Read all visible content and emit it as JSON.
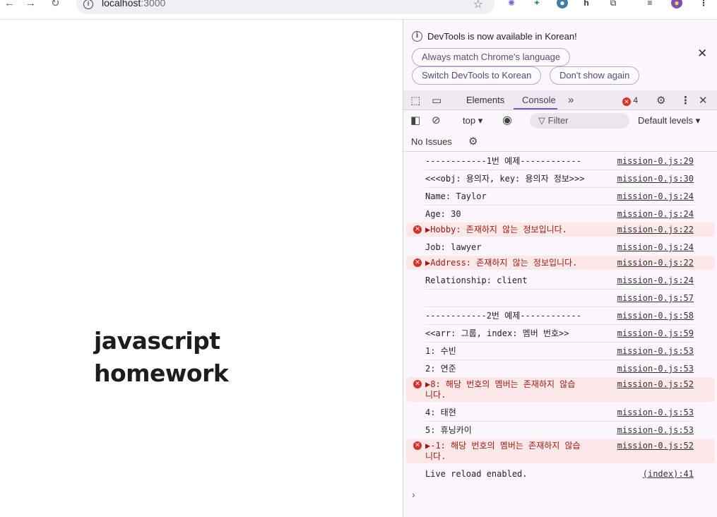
{
  "browser": {
    "url_host": "localhost",
    "url_port": ":3000"
  },
  "page": {
    "title_line1": "javascript",
    "title_line2": "homework"
  },
  "devtools": {
    "notice": {
      "text": "DevTools is now available in Korean!",
      "btn_match": "Always match Chrome's language",
      "btn_switch": "Switch DevTools to Korean",
      "btn_dont_show": "Don't show again"
    },
    "tabs": {
      "elements": "Elements",
      "console": "Console",
      "error_count": "4"
    },
    "toolbar": {
      "context": "top",
      "filter_placeholder": "Filter",
      "levels": "Default levels"
    },
    "issues": "No Issues",
    "console_rows": [
      {
        "msg": "------------1번 예제------------",
        "src": "mission-0.js:29",
        "type": "log"
      },
      {
        "msg": "<<<obj: 용의자, key: 용의자 정보>>>",
        "src": "mission-0.js:30",
        "type": "log"
      },
      {
        "msg": "Name: Taylor",
        "src": "mission-0.js:24",
        "type": "log"
      },
      {
        "msg": "Age: 30",
        "src": "mission-0.js:24",
        "type": "log"
      },
      {
        "msg": "▶Hobby: 존재하지 않는 정보입니다.",
        "src": "mission-0.js:22",
        "type": "error"
      },
      {
        "msg": "Job: lawyer",
        "src": "mission-0.js:24",
        "type": "log"
      },
      {
        "msg": "▶Address: 존재하지 않는 정보입니다.",
        "src": "mission-0.js:22",
        "type": "error"
      },
      {
        "msg": "Relationship: client",
        "src": "mission-0.js:24",
        "type": "log"
      },
      {
        "msg": "",
        "src": "mission-0.js:57",
        "type": "log"
      },
      {
        "msg": "------------2번 예제------------",
        "src": "mission-0.js:58",
        "type": "log"
      },
      {
        "msg": "<<arr: 그룹, index: 멤버 번호>>",
        "src": "mission-0.js:59",
        "type": "log"
      },
      {
        "msg": "1: 수빈",
        "src": "mission-0.js:53",
        "type": "log"
      },
      {
        "msg": "2: 연준",
        "src": "mission-0.js:53",
        "type": "log"
      },
      {
        "msg": "▶8: 해당 번호의 멤버는 존재하지 않습\n니다.",
        "src": "mission-0.js:52",
        "type": "error"
      },
      {
        "msg": "4: 태현",
        "src": "mission-0.js:53",
        "type": "log"
      },
      {
        "msg": "5: 휴닝카이",
        "src": "mission-0.js:53",
        "type": "log"
      },
      {
        "msg": "▶-1: 해당 번호의 멤버는 존재하지 않습\n니다.",
        "src": "mission-0.js:52",
        "type": "error"
      },
      {
        "msg": "Live reload enabled.",
        "src": "(index):41",
        "type": "log"
      }
    ],
    "prompt": "›"
  }
}
